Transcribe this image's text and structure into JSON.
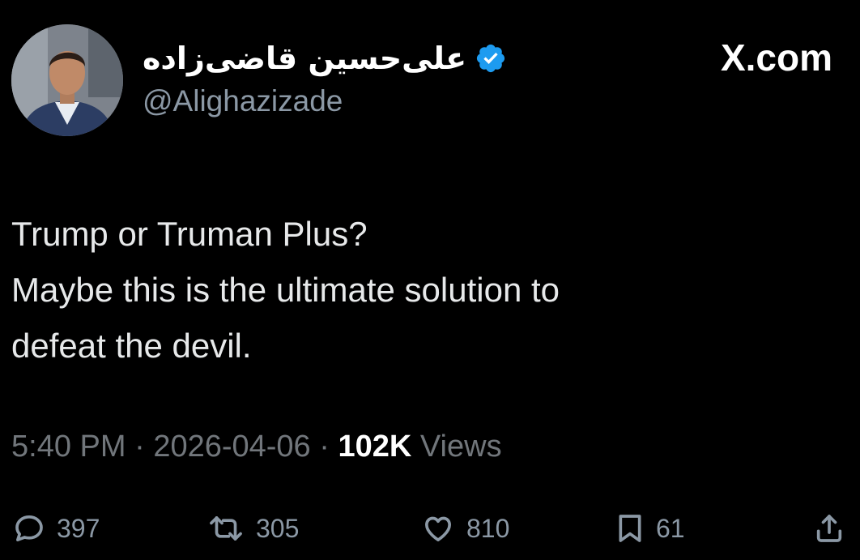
{
  "header": {
    "display_name": "علی‌حسین قاضی‌زاده",
    "handle": "@Alighazizade",
    "site_label": "X.com",
    "verified": true,
    "verified_color": "#1d9bf0"
  },
  "tweet": {
    "lines": [
      "Trump or Truman Plus?",
      "Maybe this is the ultimate solution to",
      "defeat the devil."
    ]
  },
  "meta": {
    "time": "5:40 PM",
    "separator": " · ",
    "date": "2026-04-06",
    "views_count": "102K",
    "views_label": " Views"
  },
  "actions": {
    "replies": "397",
    "reposts": "305",
    "likes": "810",
    "bookmarks": "61"
  },
  "icons": {
    "reply": "reply-icon",
    "repost": "repost-icon",
    "like": "heart-icon",
    "bookmark": "bookmark-icon",
    "share": "share-icon"
  },
  "colors": {
    "background": "#000000",
    "primary_text": "#e7e9ea",
    "secondary_text": "#71767b",
    "accent": "#1d9bf0"
  }
}
